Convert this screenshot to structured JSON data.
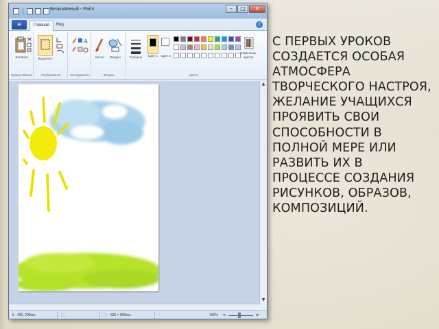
{
  "window": {
    "title": "Безымянный - Paint"
  },
  "tabs": [
    {
      "label": "Главная"
    },
    {
      "label": "Вид"
    }
  ],
  "ribbon": {
    "groups": [
      {
        "label": "Буфер обмена"
      },
      {
        "label": "Изображение"
      },
      {
        "label": "Инструменты"
      },
      {
        "label": "Фигуры"
      },
      {
        "label": "Цвета"
      }
    ],
    "buttons": {
      "paste": "Вставить",
      "select": "Выделить",
      "brushes": "Кисти",
      "shapes": "Фигуры",
      "thickness": "Толщина",
      "color1": "Цвет 1",
      "color2": "Цвет 2",
      "edit_colors": "Изменение цветов"
    },
    "palette": [
      "#000000",
      "#7f7f7f",
      "#880015",
      "#ed1c24",
      "#ff7f27",
      "#fff200",
      "#22b14c",
      "#00a2e8",
      "#3f48cc",
      "#a349a4",
      "#ffffff",
      "#c3c3c3",
      "#b97a57",
      "#ffaec9",
      "#ffc90e",
      "#efe4b0",
      "#b5e61d",
      "#99d9ea",
      "#7092be",
      "#c8bfe7"
    ]
  },
  "statusbar": {
    "position": "400, 200пкс",
    "size": "596 × 869пкс",
    "zoom": "100%"
  },
  "slide": {
    "text": "С первых уроков создается особая атмосфера творческого настроя, желание учащихся проявить свои способности в полной мере или развить их в процессе создания рисунков, образов, композиций."
  }
}
